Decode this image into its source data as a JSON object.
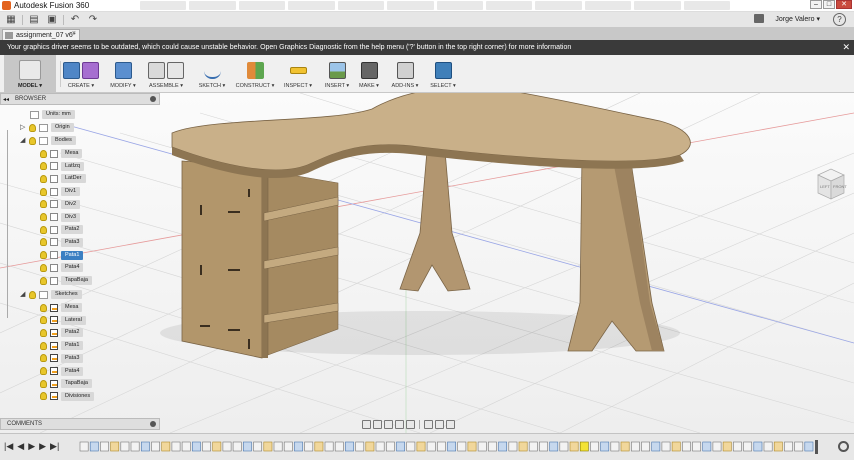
{
  "window": {
    "title": "Autodesk Fusion 360",
    "controls": [
      "–",
      "□",
      "✕"
    ]
  },
  "qat": {
    "user_name": "Jorge Valero ▾",
    "help_label": "?"
  },
  "document_tab": {
    "label": "assignment_07 v6*",
    "close": "×"
  },
  "warning": {
    "text": "Your graphics driver seems to be outdated, which could cause unstable behavior. Open Graphics Diagnostic from the help menu ('?' button in the top right corner) for more information",
    "close": "✕"
  },
  "toolbar": {
    "items": [
      {
        "label": "MODEL ▾",
        "icon": "model-cube-icon"
      },
      {
        "label": "CREATE ▾",
        "icon": "create-box-icon"
      },
      {
        "label": "MODIFY ▾",
        "icon": "modify-icon"
      },
      {
        "label": "ASSEMBLE ▾",
        "icon": "assemble-icon"
      },
      {
        "label": "SKETCH ▾",
        "icon": "sketch-icon"
      },
      {
        "label": "CONSTRUCT ▾",
        "icon": "construct-plane-icon"
      },
      {
        "label": "INSPECT ▾",
        "icon": "inspect-ruler-icon"
      },
      {
        "label": "INSERT ▾",
        "icon": "insert-image-icon"
      },
      {
        "label": "MAKE ▾",
        "icon": "make-printer-icon"
      },
      {
        "label": "ADD-INS ▾",
        "icon": "addins-icon"
      },
      {
        "label": "SELECT ▾",
        "icon": "select-cursor-icon"
      }
    ]
  },
  "browser": {
    "title": "BROWSER",
    "units": "Units: mm",
    "origin": "Origin",
    "bodies_folder": "Bodies",
    "bodies": [
      "Mesa",
      "LatIzq",
      "LatDer",
      "Div1",
      "Div2",
      "Div3",
      "Pata2",
      "Pata3",
      "Pata1",
      "Pata4",
      "TapaBaja"
    ],
    "selected_body": "Pata1",
    "sketches_folder": "Sketches",
    "sketches": [
      "Mesa",
      "Lateral",
      "Pata2",
      "Pata1",
      "Pata3",
      "Pata4",
      "TapaBaja",
      "Divisiones"
    ]
  },
  "comments": {
    "title": "COMMENTS"
  },
  "viewcube": {
    "left_face": "LEFT",
    "front_face": "FRONT"
  },
  "timeline": {
    "controls": [
      "|◀",
      "◀",
      "▶",
      "▶",
      "▶|"
    ],
    "feature_count": 72,
    "highlighted_index": 49
  },
  "colors": {
    "wood": "#b59a70",
    "wood_dark": "#8d7552",
    "accent_blue": "#3b7fc2",
    "warning_bg": "#3a3a3a"
  }
}
